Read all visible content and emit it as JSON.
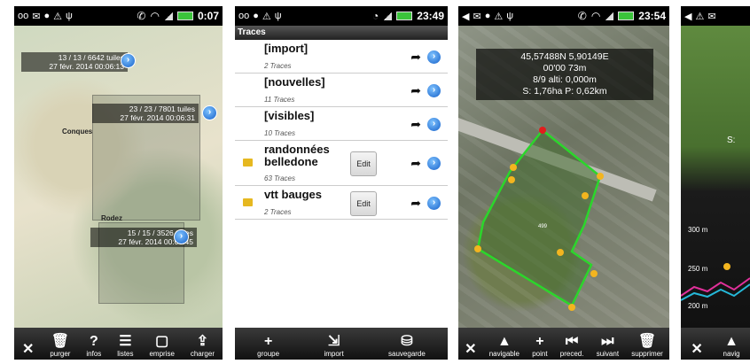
{
  "screen1": {
    "status_time": "0:07",
    "tiles": [
      {
        "count": "13 / 13 / 6642 tuiles",
        "date": "27 févr. 2014 00:06:13"
      },
      {
        "count": "23 / 23 / 7801 tuiles",
        "date": "27 févr. 2014 00:06:31"
      },
      {
        "count": "15 / 15 / 3526 tuiles",
        "date": "27 févr. 2014 00:06:45"
      }
    ],
    "map_labels": {
      "conques": "Conques",
      "rodez": "Rodez"
    },
    "toolbar": [
      {
        "icon": "close-icon",
        "label": ""
      },
      {
        "icon": "trash-icon",
        "label": "purger"
      },
      {
        "icon": "help-icon",
        "label": "infos"
      },
      {
        "icon": "list-icon",
        "label": "listes"
      },
      {
        "icon": "frame-icon",
        "label": "emprise"
      },
      {
        "icon": "upload-icon",
        "label": "charger"
      }
    ]
  },
  "screen2": {
    "status_time": "23:49",
    "title": "Traces",
    "rows": [
      {
        "name": "[import]",
        "count": "2 Traces",
        "edit": ""
      },
      {
        "name": "[nouvelles]",
        "count": "11 Traces",
        "edit": ""
      },
      {
        "name": "[visibles]",
        "count": "10 Traces",
        "edit": ""
      },
      {
        "name": "randonnées belledone",
        "count": "63 Traces",
        "edit": "Edit"
      },
      {
        "name": "vtt bauges",
        "count": "2 Traces",
        "edit": "Edit"
      }
    ],
    "toolbar": [
      {
        "icon": "plus-icon",
        "label": "groupe"
      },
      {
        "icon": "import-icon",
        "label": "import"
      },
      {
        "icon": "save-icon",
        "label": "sauvegarde"
      }
    ]
  },
  "screen3": {
    "status_time": "23:54",
    "info": {
      "coords": "45,57488N 5,90149E",
      "time_alt": "00'00  73m",
      "points": "8/9 alti: 0,000m",
      "surface": "S: 1,76ha P: 0,62km"
    },
    "field_number": "499",
    "toolbar": [
      {
        "icon": "close-icon",
        "label": ""
      },
      {
        "icon": "arrow-up-icon",
        "label": "navigable"
      },
      {
        "icon": "plus-icon",
        "label": "point"
      },
      {
        "icon": "previous-icon",
        "label": "preced."
      },
      {
        "icon": "next-icon",
        "label": "suivant"
      },
      {
        "icon": "trash-icon",
        "label": "supprimer"
      }
    ]
  },
  "screen4": {
    "elevations": [
      "300 m",
      "250 m",
      "200 m"
    ],
    "side_letter": "S:",
    "toolbar": [
      {
        "icon": "close-icon",
        "label": ""
      },
      {
        "icon": "arrow-up-icon",
        "label": "navig"
      }
    ]
  }
}
